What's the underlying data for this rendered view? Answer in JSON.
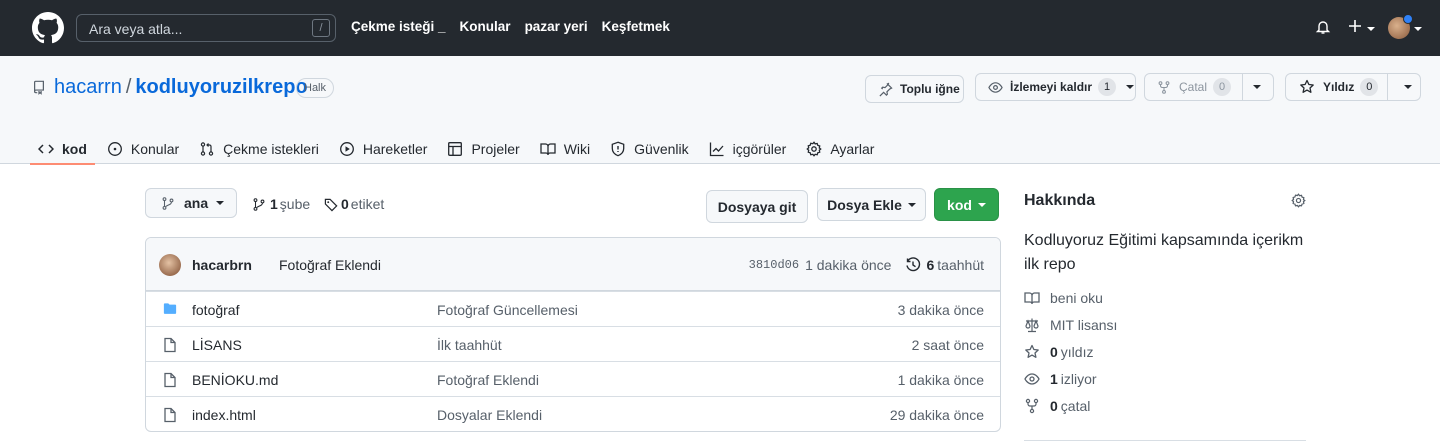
{
  "header": {
    "search_placeholder": "Ara veya atla...",
    "search_shortcut": "/",
    "nav": [
      "Çekme isteği _",
      "Konular",
      "pazar yeri",
      "Keşfetmek"
    ]
  },
  "repo": {
    "owner": "hacarrn",
    "separator": "/",
    "name": "kodluyoruzilkrepo",
    "visibility": "Halk",
    "actions": {
      "pin_label": "Toplu iğne",
      "watch_label": "İzlemeyi kaldır",
      "watch_count": "1",
      "fork_label": "Çatal",
      "fork_count": "0",
      "star_label": "Yıldız",
      "star_count": "0"
    },
    "tabs": [
      {
        "label": "kod",
        "icon": "code-icon"
      },
      {
        "label": "Konular",
        "icon": "issue-icon"
      },
      {
        "label": "Çekme istekleri",
        "icon": "pull-request-icon"
      },
      {
        "label": "Hareketler",
        "icon": "play-icon"
      },
      {
        "label": "Projeler",
        "icon": "table-icon"
      },
      {
        "label": "Wiki",
        "icon": "book-icon"
      },
      {
        "label": "Güvenlik",
        "icon": "shield-icon"
      },
      {
        "label": "içgörüler",
        "icon": "graph-icon"
      },
      {
        "label": "Ayarlar",
        "icon": "gear-icon"
      }
    ]
  },
  "toolbar": {
    "branch": "ana",
    "branch_count": "1",
    "branch_word": "şube",
    "tag_count": "0",
    "tag_word": "etiket",
    "goto_file": "Dosyaya git",
    "add_file": "Dosya Ekle",
    "code": "kod"
  },
  "commit": {
    "author": "hacarbrn",
    "message": "Fotoğraf Eklendi",
    "sha": "3810d06",
    "age": "1 dakika önce",
    "history_count": "6",
    "history_word": "taahhüt"
  },
  "files": [
    {
      "type": "folder",
      "name": "fotoğraf",
      "message": "Fotoğraf Güncellemesi",
      "age": "3 dakika önce"
    },
    {
      "type": "file",
      "name": "LİSANS",
      "message": "İlk taahhüt",
      "age": "2 saat önce"
    },
    {
      "type": "file",
      "name": "BENİOKU.md",
      "message": "Fotoğraf Eklendi",
      "age": "1 dakika önce"
    },
    {
      "type": "file",
      "name": "index.html",
      "message": "Dosyalar Eklendi",
      "age": "29 dakika önce"
    }
  ],
  "about": {
    "title": "Hakkında",
    "description": "Kodluyoruz Eğitimi kapsamında içerikm ilk repo",
    "readme": "beni oku",
    "license": "MIT lisansı",
    "stars_count": "0",
    "stars_word": "yıldız",
    "watchers_count": "1",
    "watchers_word": "izliyor",
    "forks_count": "0",
    "forks_word": "çatal"
  },
  "colors": {
    "header_bg": "#24292f",
    "link": "#0969da",
    "primary_button": "#2da44e",
    "tab_underline": "#fd8c73",
    "folder": "#54aeff"
  }
}
